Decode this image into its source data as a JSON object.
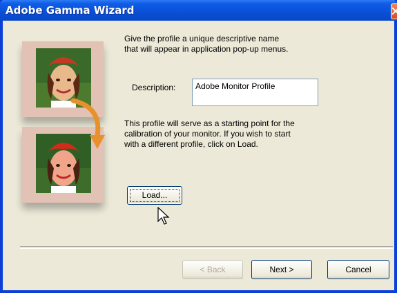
{
  "window": {
    "title": "Adobe Gamma Wizard"
  },
  "intro": {
    "line1": "Give the profile a unique descriptive name",
    "line2": "that will appear in application pop-up menus."
  },
  "description": {
    "label": "Description:",
    "value": "Adobe Monitor Profile"
  },
  "info": {
    "line1": "This profile will serve as a starting point for the",
    "line2": "calibration of your monitor. If you wish to start",
    "line3": "with a different profile, click on Load."
  },
  "buttons": {
    "load": "Load...",
    "back": "< Back",
    "next": "Next >",
    "cancel": "Cancel"
  },
  "colors": {
    "titlebar": "#0a4fd6",
    "dialog_bg": "#ece9d8",
    "frame": "#e2c2b4",
    "arrow": "#e8902c"
  }
}
